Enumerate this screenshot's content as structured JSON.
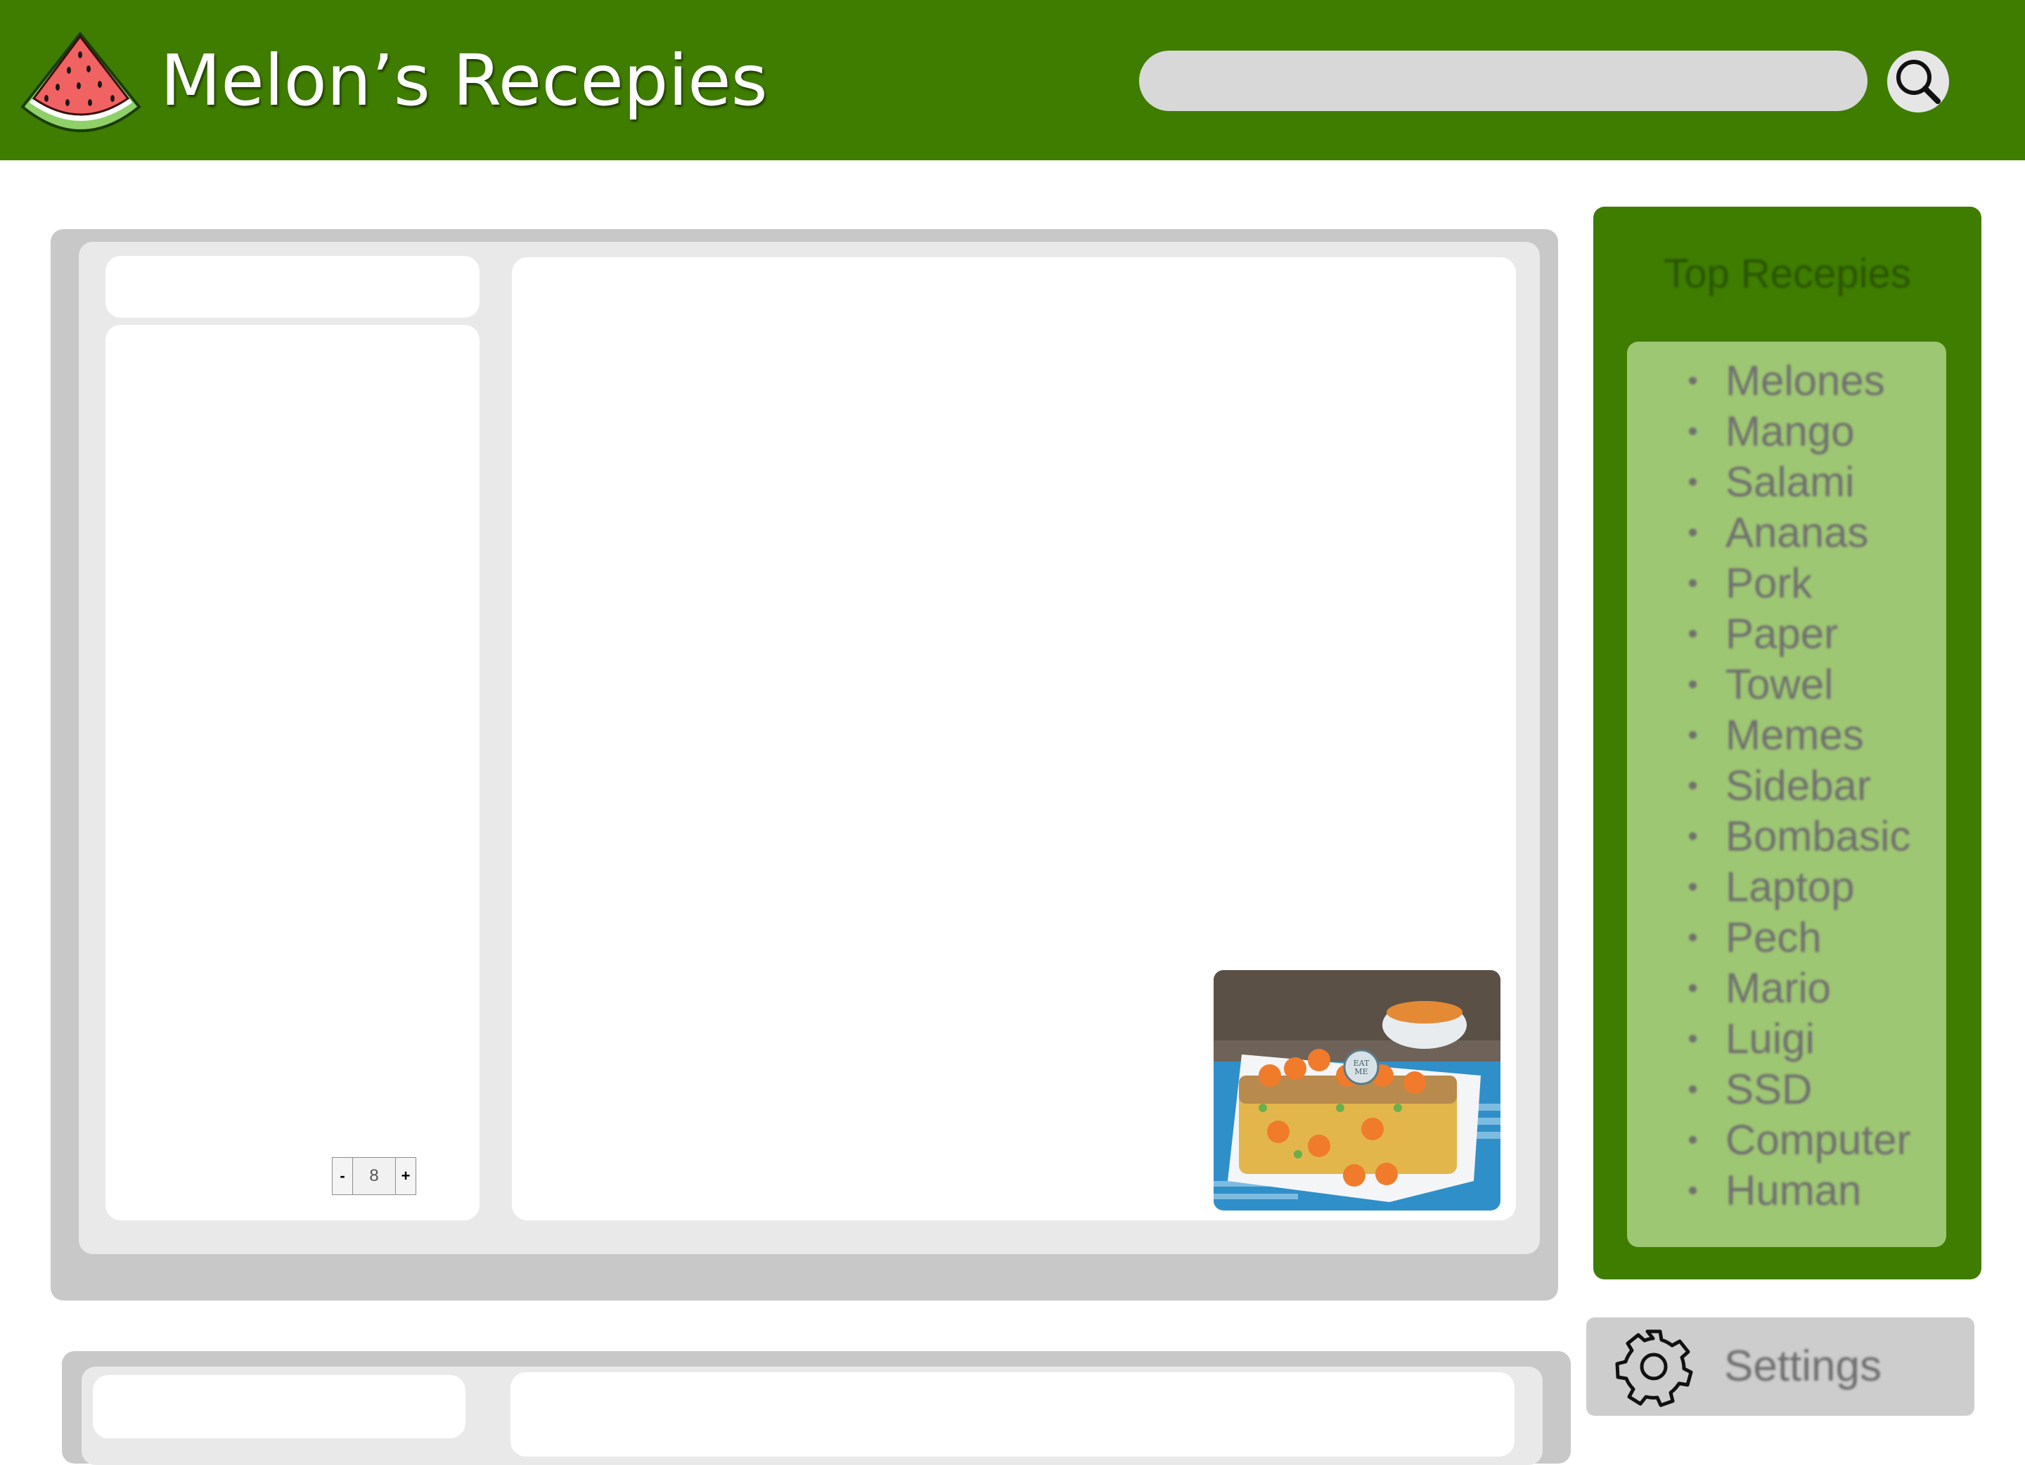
{
  "header": {
    "title": "Melon’s Recepies",
    "logo_icon": "watermelon-slice-icon",
    "search": {
      "placeholder": "",
      "value": ""
    },
    "search_icon": "magnifier-icon",
    "colors": {
      "bar": "#3f7d00",
      "search_field": "#d8d8d8"
    }
  },
  "recipe_cards": [
    {
      "servings": {
        "decrement_label": "-",
        "value": "8",
        "increment_label": "+"
      },
      "image": "fruit-crumble-cake-photo",
      "image_text": "EAT ME"
    },
    {}
  ],
  "sidebar": {
    "top_title": "Top Recepies",
    "items": [
      "Melones",
      "Mango",
      "Salami",
      "Ananas",
      "Pork",
      "Paper",
      "Towel",
      "Memes",
      "Sidebar",
      "Bombasic",
      "Laptop",
      "Pech",
      "Mario",
      "Luigi",
      "SSD",
      "Computer",
      "Human"
    ],
    "settings_label": "Settings",
    "settings_icon": "gear-icon",
    "colors": {
      "box": "#3f7d00",
      "list": "#9ec773",
      "settings": "#cdcdcd"
    }
  }
}
